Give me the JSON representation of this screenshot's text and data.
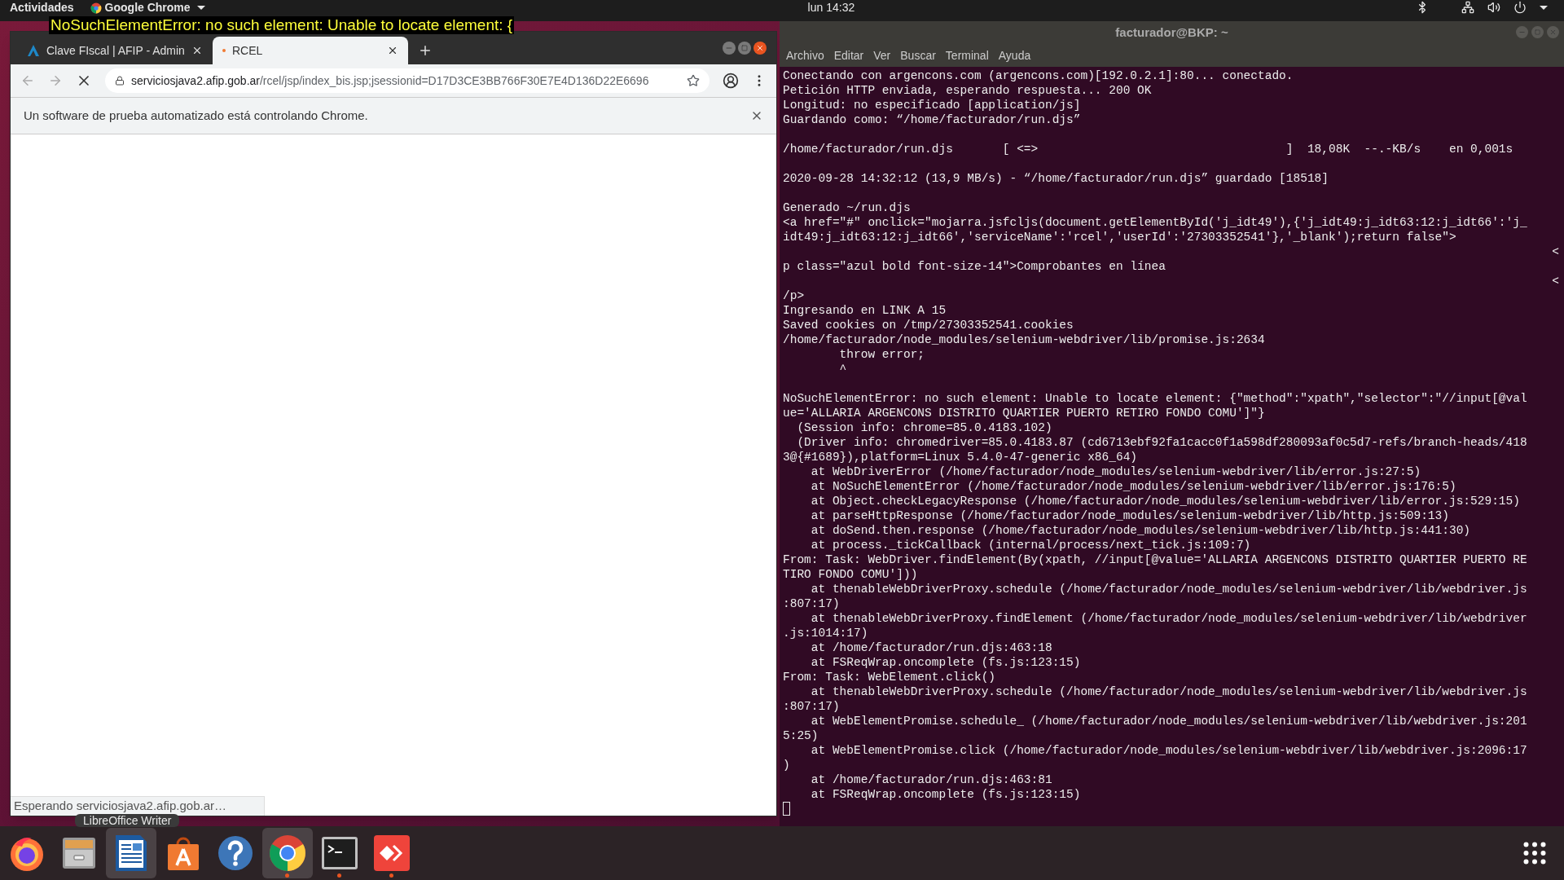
{
  "top_bar": {
    "activities": "Actividades",
    "app_menu": "Google Chrome",
    "clock": "lun 14:32"
  },
  "overlay_message": "NoSuchElementError: no such element: Unable to locate element: {",
  "browser": {
    "tabs": [
      {
        "title": "Clave FIscal | AFIP - Admin",
        "kind": "afip",
        "selected": false
      },
      {
        "title": "RCEL",
        "kind": "loading",
        "selected": true
      }
    ],
    "url": {
      "host": "serviciosjava2.afip.gob.ar",
      "path": "/rcel/jsp/index_bis.jsp;jsessionid=D17D3CE3BB766F30E7E4D136D22E6696"
    },
    "infobar": "Un software de prueba automatizado está controlando Chrome.",
    "status": "Esperando serviciosjava2.afip.gob.ar…"
  },
  "terminal": {
    "title": "facturador@BKP: ~",
    "menu": [
      "Archivo",
      "Editar",
      "Ver",
      "Buscar",
      "Terminal",
      "Ayuda"
    ],
    "lines": [
      {
        "kind": "line",
        "text": "Conectando con argencons.com (argencons.com)[192.0.2.1]:80... conectado."
      },
      {
        "kind": "line",
        "text": "Petición HTTP enviada, esperando respuesta... 200 OK"
      },
      {
        "kind": "line",
        "text": "Longitud: no especificado [application/js]"
      },
      {
        "kind": "line",
        "text": "Guardando como: “/home/facturador/run.djs”"
      },
      {
        "kind": "blank"
      },
      {
        "kind": "line",
        "text": "/home/facturador/run.djs       [ <=>                                   ]  18,08K  --.-KB/s    en 0,001s"
      },
      {
        "kind": "blank"
      },
      {
        "kind": "line",
        "text": "2020-09-28 14:32:12 (13,9 MB/s) - “/home/facturador/run.djs” guardado [18518]"
      },
      {
        "kind": "blank"
      },
      {
        "kind": "line",
        "text": "Generado ~/run.djs"
      },
      {
        "kind": "line",
        "text": "<a href=\"#\" onclick=\"mojarra.jsfcljs(document.getElementById('j_idt49'),{'j_idt49:j_idt63:12:j_idt66':'j_"
      },
      {
        "kind": "line",
        "text": "idt49:j_idt63:12:j_idt66','serviceName':'rcel','userId':'27303352541'},'_blank');return false\">"
      },
      {
        "kind": "right",
        "text": "<"
      },
      {
        "kind": "line",
        "text": "p class=\"azul bold font-size-14\">Comprobantes en línea"
      },
      {
        "kind": "right",
        "text": "<"
      },
      {
        "kind": "line",
        "text": "/p>"
      },
      {
        "kind": "line",
        "text": "Ingresando en LINK A 15"
      },
      {
        "kind": "line",
        "text": "Saved cookies on /tmp/27303352541.cookies"
      },
      {
        "kind": "line",
        "text": "/home/facturador/node_modules/selenium-webdriver/lib/promise.js:2634"
      },
      {
        "kind": "line",
        "text": "        throw error;"
      },
      {
        "kind": "line",
        "text": "        ^"
      },
      {
        "kind": "blank"
      },
      {
        "kind": "line",
        "text": "NoSuchElementError: no such element: Unable to locate element: {\"method\":\"xpath\",\"selector\":\"//input[@val"
      },
      {
        "kind": "line",
        "text": "ue='ALLARIA ARGENCONS DISTRITO QUARTIER PUERTO RETIRO FONDO COMU']\"}"
      },
      {
        "kind": "line",
        "text": "  (Session info: chrome=85.0.4183.102)"
      },
      {
        "kind": "line",
        "text": "  (Driver info: chromedriver=85.0.4183.87 (cd6713ebf92fa1cacc0f1a598df280093af0c5d7-refs/branch-heads/418"
      },
      {
        "kind": "line",
        "text": "3@{#1689}),platform=Linux 5.4.0-47-generic x86_64)"
      },
      {
        "kind": "line",
        "text": "    at WebDriverError (/home/facturador/node_modules/selenium-webdriver/lib/error.js:27:5)"
      },
      {
        "kind": "line",
        "text": "    at NoSuchElementError (/home/facturador/node_modules/selenium-webdriver/lib/error.js:176:5)"
      },
      {
        "kind": "line",
        "text": "    at Object.checkLegacyResponse (/home/facturador/node_modules/selenium-webdriver/lib/error.js:529:15)"
      },
      {
        "kind": "line",
        "text": "    at parseHttpResponse (/home/facturador/node_modules/selenium-webdriver/lib/http.js:509:13)"
      },
      {
        "kind": "line",
        "text": "    at doSend.then.response (/home/facturador/node_modules/selenium-webdriver/lib/http.js:441:30)"
      },
      {
        "kind": "line",
        "text": "    at process._tickCallback (internal/process/next_tick.js:109:7)"
      },
      {
        "kind": "line",
        "text": "From: Task: WebDriver.findElement(By(xpath, //input[@value='ALLARIA ARGENCONS DISTRITO QUARTIER PUERTO RE"
      },
      {
        "kind": "line",
        "text": "TIRO FONDO COMU']))"
      },
      {
        "kind": "line",
        "text": "    at thenableWebDriverProxy.schedule (/home/facturador/node_modules/selenium-webdriver/lib/webdriver.js"
      },
      {
        "kind": "line",
        "text": ":807:17)"
      },
      {
        "kind": "line",
        "text": "    at thenableWebDriverProxy.findElement (/home/facturador/node_modules/selenium-webdriver/lib/webdriver"
      },
      {
        "kind": "line",
        "text": ".js:1014:17)"
      },
      {
        "kind": "line",
        "text": "    at /home/facturador/run.djs:463:18"
      },
      {
        "kind": "line",
        "text": "    at FSReqWrap.oncomplete (fs.js:123:15)"
      },
      {
        "kind": "line",
        "text": "From: Task: WebElement.click()"
      },
      {
        "kind": "line",
        "text": "    at thenableWebDriverProxy.schedule (/home/facturador/node_modules/selenium-webdriver/lib/webdriver.js"
      },
      {
        "kind": "line",
        "text": ":807:17)"
      },
      {
        "kind": "line",
        "text": "    at WebElementPromise.schedule_ (/home/facturador/node_modules/selenium-webdriver/lib/webdriver.js:201"
      },
      {
        "kind": "line",
        "text": "5:25)"
      },
      {
        "kind": "line",
        "text": "    at WebElementPromise.click (/home/facturador/node_modules/selenium-webdriver/lib/webdriver.js:2096:17"
      },
      {
        "kind": "line",
        "text": ")"
      },
      {
        "kind": "line",
        "text": "    at /home/facturador/run.djs:463:81"
      },
      {
        "kind": "line",
        "text": "    at FSReqWrap.oncomplete (fs.js:123:15)"
      },
      {
        "kind": "cursor"
      }
    ]
  },
  "dock": {
    "tooltip": "LibreOffice Writer",
    "apps": [
      {
        "kind": "firefox",
        "highlighted": false,
        "running": false
      },
      {
        "kind": "files",
        "highlighted": false,
        "running": false
      },
      {
        "kind": "writer",
        "highlighted": true,
        "running": false
      },
      {
        "kind": "software",
        "highlighted": false,
        "running": false
      },
      {
        "kind": "help",
        "highlighted": false,
        "running": false
      },
      {
        "kind": "chrome",
        "highlighted": true,
        "running": true
      },
      {
        "kind": "terminal",
        "highlighted": false,
        "running": true
      },
      {
        "kind": "anydesk",
        "highlighted": false,
        "running": true
      }
    ]
  }
}
